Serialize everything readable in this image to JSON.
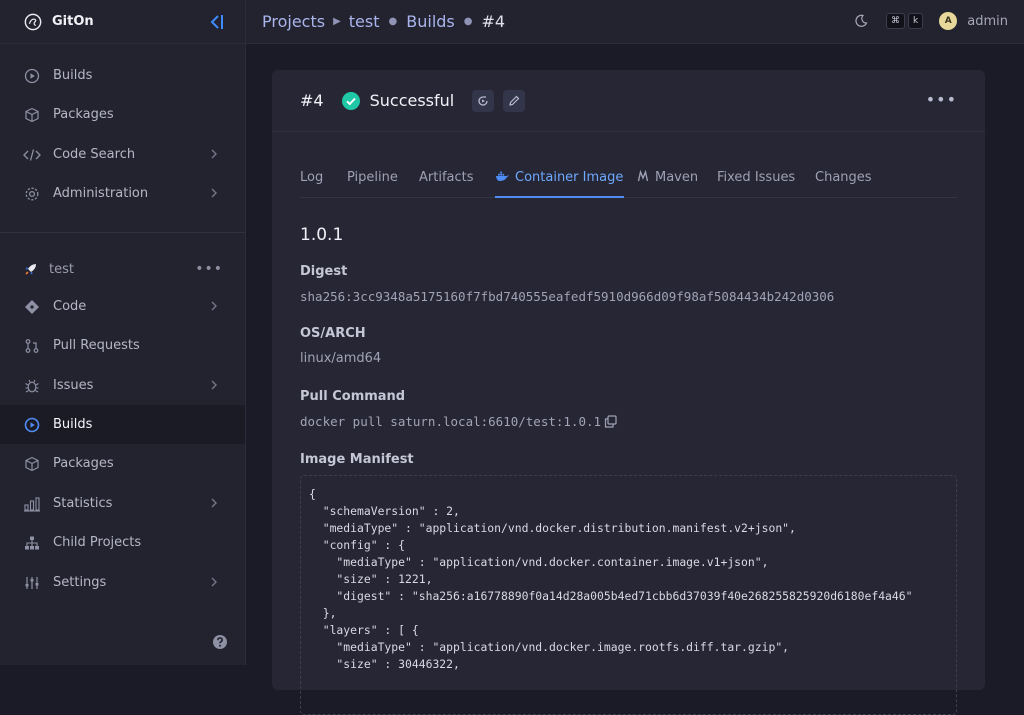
{
  "app": {
    "name": "GitOn"
  },
  "sidebar": {
    "global_items": [
      {
        "label": "Builds",
        "icon": "play-circle-icon"
      },
      {
        "label": "Packages",
        "icon": "package-icon"
      },
      {
        "label": "Code Search",
        "icon": "code-icon"
      },
      {
        "label": "Administration",
        "icon": "gear-icon"
      }
    ],
    "project": {
      "name": "test",
      "more": "•••"
    },
    "project_items": [
      {
        "label": "Code",
        "icon": "git-commit-icon"
      },
      {
        "label": "Pull Requests",
        "icon": "pull-request-icon"
      },
      {
        "label": "Issues",
        "icon": "bug-icon"
      },
      {
        "label": "Builds",
        "icon": "play-circle-icon",
        "active": true
      },
      {
        "label": "Packages",
        "icon": "package-icon"
      },
      {
        "label": "Statistics",
        "icon": "bar-chart-icon"
      },
      {
        "label": "Child Projects",
        "icon": "hierarchy-icon"
      },
      {
        "label": "Settings",
        "icon": "sliders-icon"
      }
    ]
  },
  "topbar": {
    "crumbs": [
      "Projects",
      "test",
      "Builds",
      "#4"
    ],
    "kbd1": "⌘",
    "kbd2": "k",
    "avatar_letter": "A",
    "user": "admin"
  },
  "build": {
    "number": "#4",
    "status": "Successful",
    "more": "•••"
  },
  "tabs": [
    "Log",
    "Pipeline",
    "Artifacts",
    "Container Image",
    "Maven",
    "Fixed Issues",
    "Changes"
  ],
  "image": {
    "version": "1.0.1",
    "digest_label": "Digest",
    "digest": "sha256:3cc9348a5175160f7fbd740555eafedf5910d966d09f98af5084434b242d0306",
    "osarch_label": "OS/ARCH",
    "osarch": "linux/amd64",
    "pull_label": "Pull Command",
    "pull": "docker pull saturn.local:6610/test:1.0.1",
    "manifest_label": "Image Manifest",
    "manifest": "{\n  \"schemaVersion\" : 2,\n  \"mediaType\" : \"application/vnd.docker.distribution.manifest.v2+json\",\n  \"config\" : {\n    \"mediaType\" : \"application/vnd.docker.container.image.v1+json\",\n    \"size\" : 1221,\n    \"digest\" : \"sha256:a16778890f0a14d28a005b4ed71cbb6d37039f40e268255825920d6180ef4a46\"\n  },\n  \"layers\" : [ {\n    \"mediaType\" : \"application/vnd.docker.image.rootfs.diff.tar.gzip\",\n    \"size\" : 30446322,"
  },
  "colors": {
    "accent": "#4f8df5",
    "success": "#1fc7a6"
  }
}
